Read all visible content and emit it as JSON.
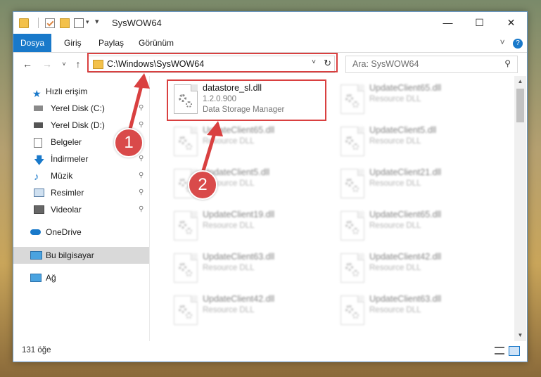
{
  "window": {
    "title": "SysWOW64",
    "minimize": "—",
    "maximize": "☐",
    "close": "✕"
  },
  "ribbon": {
    "tabs": [
      "Dosya",
      "Giriş",
      "Paylaş",
      "Görünüm"
    ],
    "expand": "˅",
    "help": "?"
  },
  "nav": {
    "back": "←",
    "forward": "→",
    "up_dropdown": "˅",
    "up": "↑",
    "address": "C:\\Windows\\SysWOW64",
    "address_dropdown": "˅",
    "refresh": "↻",
    "search_placeholder": "Ara: SysWOW64"
  },
  "sidebar": {
    "items": [
      {
        "label": "Hızlı erişim",
        "icon": "star-icon",
        "pinned": false
      },
      {
        "label": "Yerel Disk (C:)",
        "icon": "drive-icon",
        "pinned": true
      },
      {
        "label": "Yerel Disk (D:)",
        "icon": "drive-icon",
        "pinned": true
      },
      {
        "label": "Belgeler",
        "icon": "documents-icon",
        "pinned": true
      },
      {
        "label": "İndirmeler",
        "icon": "download-icon",
        "pinned": true
      },
      {
        "label": "Müzik",
        "icon": "music-icon",
        "pinned": true
      },
      {
        "label": "Resimler",
        "icon": "pictures-icon",
        "pinned": true
      },
      {
        "label": "Videolar",
        "icon": "videos-icon",
        "pinned": true
      },
      {
        "label": "OneDrive",
        "icon": "cloud-icon",
        "pinned": false
      },
      {
        "label": "Bu bilgisayar",
        "icon": "computer-icon",
        "pinned": false
      },
      {
        "label": "Ağ",
        "icon": "network-icon",
        "pinned": false
      }
    ],
    "pin_glyph": "📌"
  },
  "files": [
    {
      "name": "datastore_sl.dll",
      "version": "1.2.0.900",
      "description": "Data Storage Manager"
    },
    {
      "name": "UpdateClient65.dll",
      "version": "Resource DLL",
      "description": ""
    },
    {
      "name": "UpdateClient65.dll",
      "version": "Resource DLL",
      "description": ""
    },
    {
      "name": "UpdateClient5.dll",
      "version": "Resource DLL",
      "description": ""
    },
    {
      "name": "UpdateClient5.dll",
      "version": "Resource DLL",
      "description": ""
    },
    {
      "name": "UpdateClient21.dll",
      "version": "Resource DLL",
      "description": ""
    },
    {
      "name": "UpdateClient19.dll",
      "version": "Resource DLL",
      "description": ""
    },
    {
      "name": "UpdateClient65.dll",
      "version": "Resource DLL",
      "description": ""
    },
    {
      "name": "UpdateClient63.dll",
      "version": "Resource DLL",
      "description": ""
    },
    {
      "name": "UpdateClient42.dll",
      "version": "Resource DLL",
      "description": ""
    },
    {
      "name": "UpdateClient42.dll",
      "version": "Resource DLL",
      "description": ""
    },
    {
      "name": "UpdateClient63.dll",
      "version": "Resource DLL",
      "description": ""
    }
  ],
  "status": {
    "count": "131 öğe"
  },
  "annotations": {
    "step1": "1",
    "step2": "2",
    "color": "#d94040"
  }
}
